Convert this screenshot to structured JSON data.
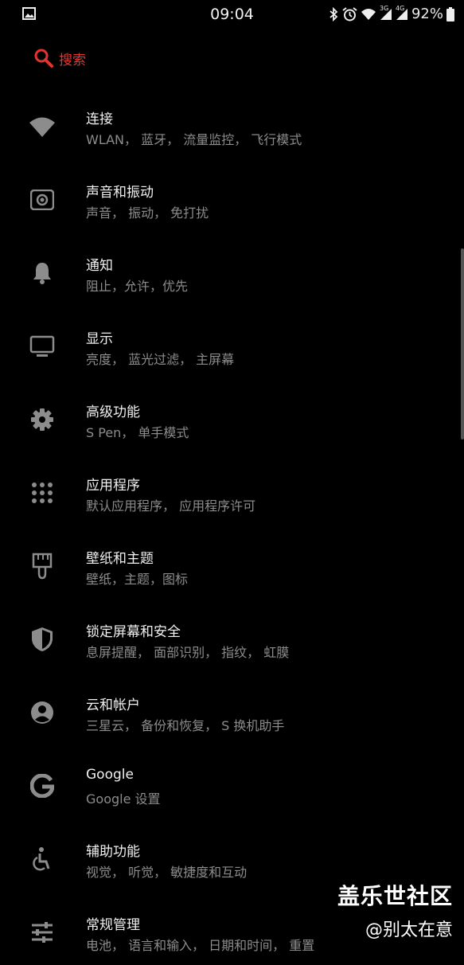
{
  "status_bar": {
    "time": "09:04",
    "battery": "92%",
    "network_labels": [
      "3G",
      "4G"
    ]
  },
  "search": {
    "label": "搜索",
    "color": "#e3342f"
  },
  "settings": [
    {
      "icon": "wifi-icon",
      "title": "连接",
      "subtitle": "WLAN， 蓝牙， 流量监控， 飞行模式"
    },
    {
      "icon": "sound-vibration-icon",
      "title": "声音和振动",
      "subtitle": "声音， 振动， 免打扰"
    },
    {
      "icon": "bell-icon",
      "title": "通知",
      "subtitle": "阻止，允许，优先"
    },
    {
      "icon": "monitor-icon",
      "title": "显示",
      "subtitle": "亮度， 蓝光过滤， 主屏幕"
    },
    {
      "icon": "gear-icon",
      "title": "高级功能",
      "subtitle": "S Pen， 单手模式"
    },
    {
      "icon": "apps-grid-icon",
      "title": "应用程序",
      "subtitle": "默认应用程序， 应用程序许可"
    },
    {
      "icon": "brush-icon",
      "title": "壁纸和主题",
      "subtitle": "壁纸，主题，图标"
    },
    {
      "icon": "shield-icon",
      "title": "锁定屏幕和安全",
      "subtitle": "息屏提醒， 面部识别， 指纹， 虹膜"
    },
    {
      "icon": "account-icon",
      "title": "云和帐户",
      "subtitle": "三星云， 备份和恢复， S 换机助手"
    },
    {
      "icon": "google-icon",
      "title": "Google",
      "subtitle": "Google 设置"
    },
    {
      "icon": "accessibility-icon",
      "title": "辅助功能",
      "subtitle": "视觉， 听觉， 敏捷度和互动"
    },
    {
      "icon": "sliders-icon",
      "title": "常规管理",
      "subtitle": "电池， 语言和输入， 日期和时间， 重置"
    }
  ],
  "watermark": {
    "line1": "盖乐世社区",
    "line2": "@别太在意"
  }
}
